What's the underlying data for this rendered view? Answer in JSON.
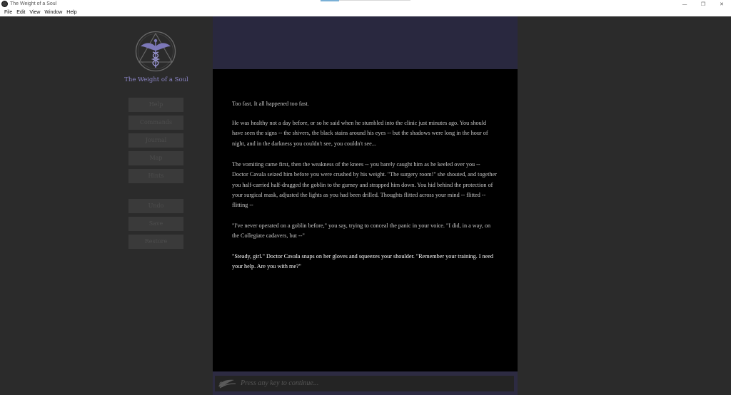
{
  "window": {
    "title": "The Weight of a Soul",
    "controls": {
      "minimize": "—",
      "restore": "❐",
      "close": "✕"
    }
  },
  "menu": [
    "File",
    "Edit",
    "View",
    "Window",
    "Help"
  ],
  "sidebar": {
    "game_title": "The Weight of a Soul",
    "logo_icon": "winged-caduceus-triangle-icon",
    "buttons": [
      "Help",
      "Commands",
      "Journal",
      "Map",
      "Hints",
      "Undo",
      "Save",
      "Restore"
    ]
  },
  "story": {
    "paragraphs": [
      "Too fast. It all happened too fast.",
      "He was healthy not a day before, or so he said when he stumbled into the clinic just minutes ago. You should have seen the signs -- the shivers, the black stains around his eyes -- but the shadows were long in the hour of night, and in the darkness you couldn't see, you couldn't see...",
      "The vomiting came first, then the weakness of the knees -- you barely caught him as he keeled over you -- Doctor Cavala seized him before you were crushed by his weight. \"The surgery room!\" she shouted, and together you half-carried half-dragged the goblin to the gurney and strapped him down. You hid behind the protection of your surgical mask, adjusted the lights as you had been drilled. Thoughts flitted across your mind -- flitted -- flitting --",
      "\"I've never operated on a goblin before,\" you say, trying to conceal the panic in your voice. \"I did, in a way, on the Collegiate cadavers, but --\"",
      "\"Steady, girl.\" Doctor Cavala snaps on her gloves and squeezes your shoulder. \"Remember your training. I need your help. Are you with me?\""
    ]
  },
  "input": {
    "prompt": "Press any key to continue...",
    "icon": "quill-icon"
  },
  "colors": {
    "background": "#2b2b2b",
    "banner": "#29283f",
    "story_bg": "#000000",
    "title_accent": "#8c86c8",
    "current_text": "#ffffff",
    "past_text": "#c8c8c8"
  }
}
